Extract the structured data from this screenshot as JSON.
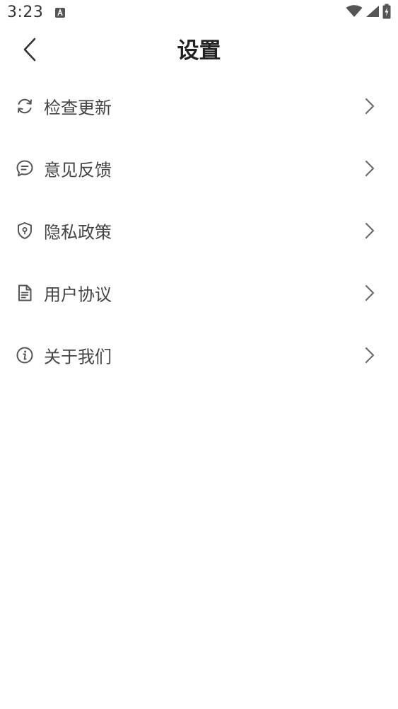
{
  "status_bar": {
    "time": "3:23",
    "app_icon": "a-letter-icon",
    "wifi_icon": "wifi-icon",
    "signal_icon": "cell-signal-icon",
    "battery_icon": "battery-charging-icon"
  },
  "header": {
    "title": "设置",
    "back_icon": "chevron-left-icon"
  },
  "settings": {
    "items": [
      {
        "label": "检查更新",
        "icon": "refresh-icon"
      },
      {
        "label": "意见反馈",
        "icon": "chat-bubble-icon"
      },
      {
        "label": "隐私政策",
        "icon": "shield-icon"
      },
      {
        "label": "用户协议",
        "icon": "document-icon"
      },
      {
        "label": "关于我们",
        "icon": "info-icon"
      }
    ]
  },
  "colors": {
    "background": "#ffffff",
    "title_text": "#222222",
    "item_text": "#444444",
    "icon": "#555555",
    "chevron": "#666666"
  }
}
